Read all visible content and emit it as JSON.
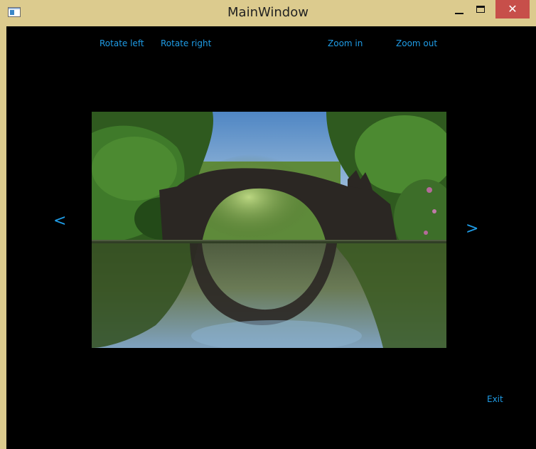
{
  "window": {
    "title": "MainWindow",
    "close_glyph": "✕"
  },
  "toolbar": {
    "rotate_left": "Rotate left",
    "rotate_right": "Rotate right",
    "zoom_in": "Zoom in",
    "zoom_out": "Zoom out"
  },
  "navigation": {
    "prev": "<",
    "next": ">"
  },
  "footer": {
    "exit": "Exit"
  },
  "image": {
    "subject": "arched stone bridge reflected in a lake forming a circle, surrounded by green trees"
  },
  "colors": {
    "title_bar": "#dccb8e",
    "close_button": "#c74f4a",
    "canvas_bg": "#000000",
    "link_text": "#1f9ce6"
  },
  "icons": {
    "app": "app-window-icon",
    "minimize": "minimize-icon",
    "maximize": "maximize-icon",
    "close": "close-icon",
    "prev": "chevron-left-icon",
    "next": "chevron-right-icon"
  }
}
